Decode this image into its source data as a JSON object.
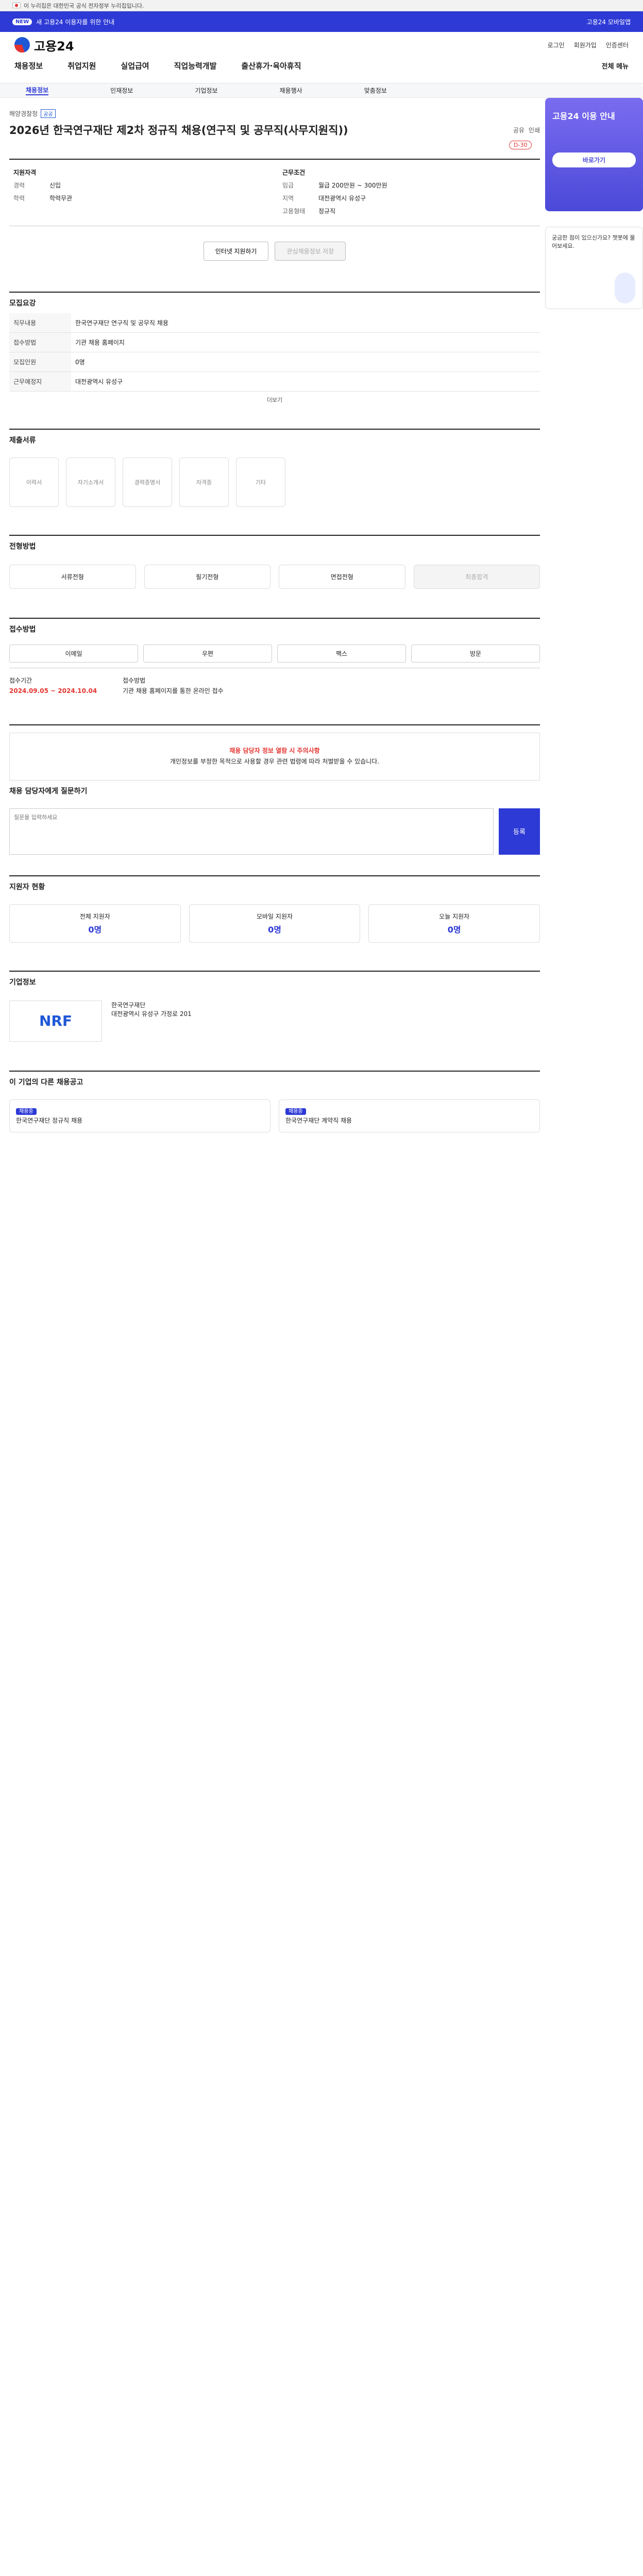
{
  "gov": {
    "text": "이 누리집은 대한민국 공식 전자정부 누리집입니다."
  },
  "promo": {
    "tag": "NEW",
    "text": "새 고용24 이용자를 위한 안내",
    "right": "고용24 모바일앱"
  },
  "header": {
    "logo": "고용24",
    "util": [
      "로그인",
      "회원가입",
      "인증센터"
    ],
    "nav": [
      "채용정보",
      "취업지원",
      "실업급여",
      "직업능력개발",
      "출산휴가·육아휴직"
    ],
    "menu_all": "전체 메뉴",
    "subnav": [
      "채용정보",
      "인재정보",
      "기업정보",
      "채용행사",
      "맞춤정보"
    ]
  },
  "banner": {
    "title": "고용24 이용 안내",
    "btn": "바로가기",
    "bot": "궁금한 점이 있으신가요? 챗봇에 물어보세요."
  },
  "posting": {
    "agency": "해양경찰청",
    "badge": "공공",
    "title": "2026년 한국연구재단 제2차 정규직 채용(연구직 및 공무직(사무지원직))",
    "share": [
      "공유",
      "인쇄"
    ],
    "dday": "D-30"
  },
  "summary": {
    "left_head": "지원자격",
    "left": [
      [
        "경력",
        "신입"
      ],
      [
        "학력",
        "학력무관"
      ]
    ],
    "right_head": "근무조건",
    "right": [
      [
        "임금",
        "월급 200만원 ~ 300만원"
      ],
      [
        "지역",
        "대전광역시 유성구"
      ],
      [
        "고용형태",
        "정규직"
      ]
    ],
    "btn_apply": "인터넷 지원하기",
    "btn_scrap": "관심채용정보 저장"
  },
  "detail": {
    "head": "모집요강",
    "rows": [
      [
        "직무내용",
        "한국연구재단 연구직 및 공무직 채용"
      ],
      [
        "접수방법",
        "기관 채용 홈페이지"
      ],
      [
        "모집인원",
        "0명"
      ],
      [
        "근무예정지",
        "대전광역시 유성구"
      ]
    ],
    "more": "더보기"
  },
  "files": {
    "head": "제출서류",
    "items": [
      "이력서",
      "자기소개서",
      "경력증명서",
      "자격증",
      "기타"
    ]
  },
  "steps": {
    "head": "전형방법",
    "items": [
      "서류전형",
      "필기전형",
      "면접전형",
      "최종합격"
    ]
  },
  "apply": {
    "head": "접수방법",
    "tabs": [
      "이메일",
      "우편",
      "팩스",
      "방문"
    ],
    "period_label": "접수기간",
    "period": "2024.09.05 ~ 2024.10.04",
    "method_label": "접수방법",
    "method": "기관 채용 홈페이지를 통한 온라인 접수"
  },
  "warning": {
    "title": "채용 담당자 정보 열람 시 주의사항",
    "body": "개인정보를 부정한 목적으로 사용할 경우 관련 법령에 따라 처벌받을 수 있습니다."
  },
  "qa": {
    "head": "채용 담당자에게 질문하기",
    "placeholder": "질문을 입력하세요",
    "btn": "등록"
  },
  "stats": {
    "head": "지원자 현황",
    "items": [
      [
        "전체 지원자",
        "0명"
      ],
      [
        "모바일 지원자",
        "0명"
      ],
      [
        "오늘 지원자",
        "0명"
      ]
    ]
  },
  "corp": {
    "head": "기업정보",
    "logo": "NRF",
    "name": "한국연구재단",
    "addr": "대전광역시 유성구 가정로 201"
  },
  "others": {
    "head": "이 기업의 다른 채용공고",
    "cards": [
      [
        "채용중",
        "한국연구재단 정규직 채용"
      ],
      [
        "채용중",
        "한국연구재단 계약직 채용"
      ]
    ]
  }
}
